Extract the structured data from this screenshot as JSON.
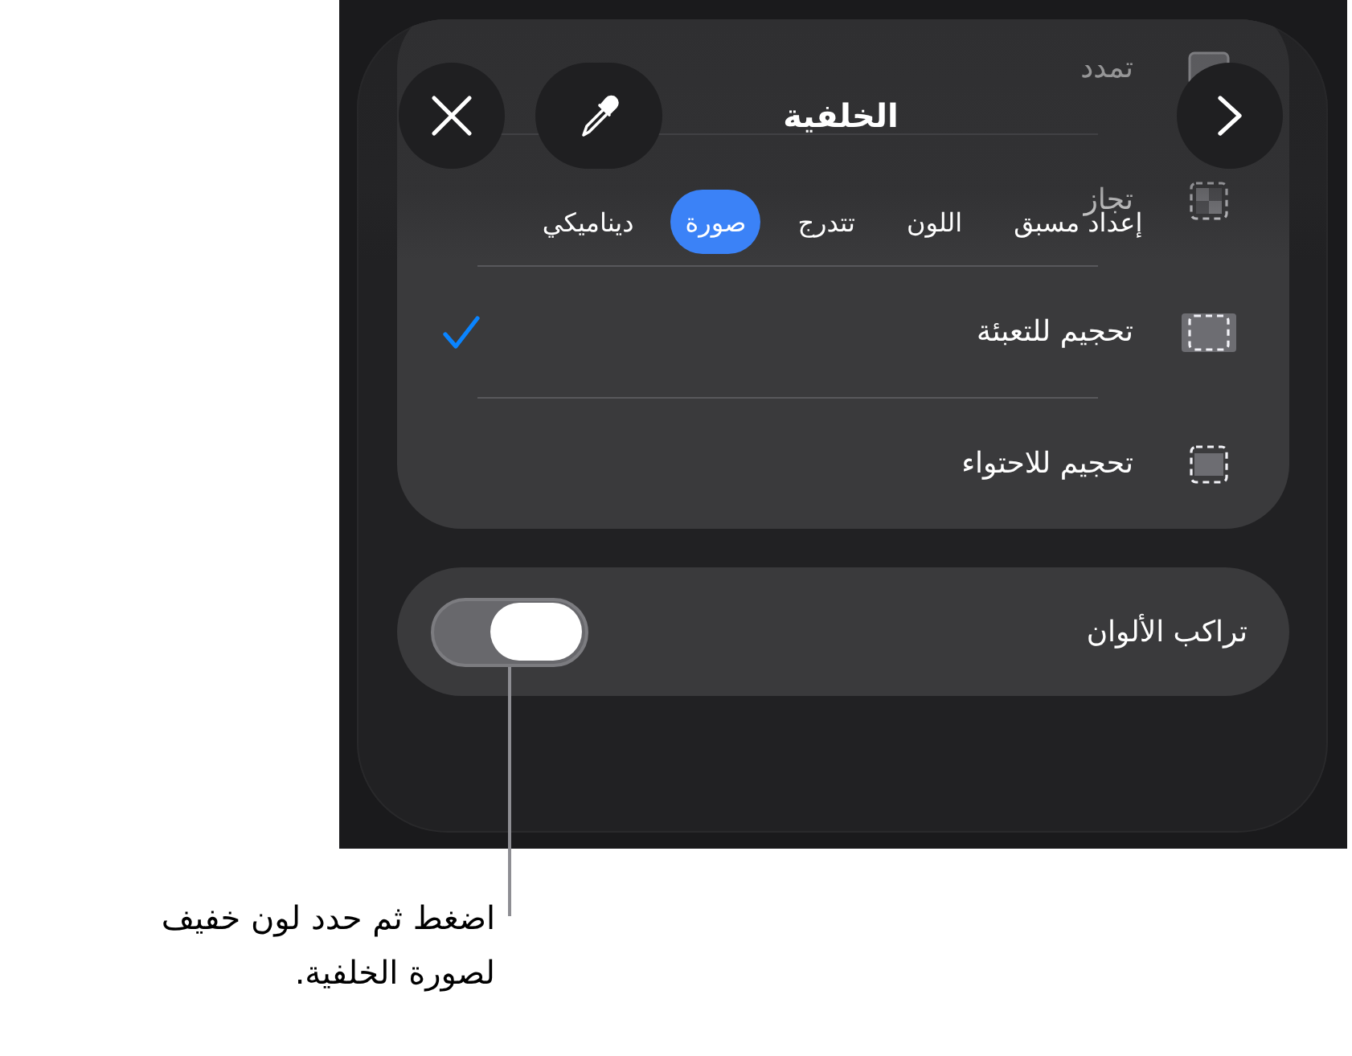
{
  "header": {
    "title": "الخلفية"
  },
  "tabs": [
    {
      "label": "إعداد مسبق",
      "selected": false
    },
    {
      "label": "اللون",
      "selected": false
    },
    {
      "label": "تتدرج",
      "selected": false
    },
    {
      "label": "صورة",
      "selected": true
    },
    {
      "label": "ديناميكي",
      "selected": false
    }
  ],
  "rows": [
    {
      "kind": "stretch",
      "label": "تمدد",
      "checked": false
    },
    {
      "kind": "tile",
      "label": "تجاز",
      "checked": false
    },
    {
      "kind": "fill",
      "label": "تحجيم للتعبئة",
      "checked": true
    },
    {
      "kind": "fit",
      "label": "تحجيم للاحتواء",
      "checked": false
    }
  ],
  "overlay_toggle": {
    "label": "تراكب الألوان",
    "on": false
  },
  "callout": {
    "text": "اضغط ثم حدد لون خفيف\nلصورة الخلفية."
  }
}
